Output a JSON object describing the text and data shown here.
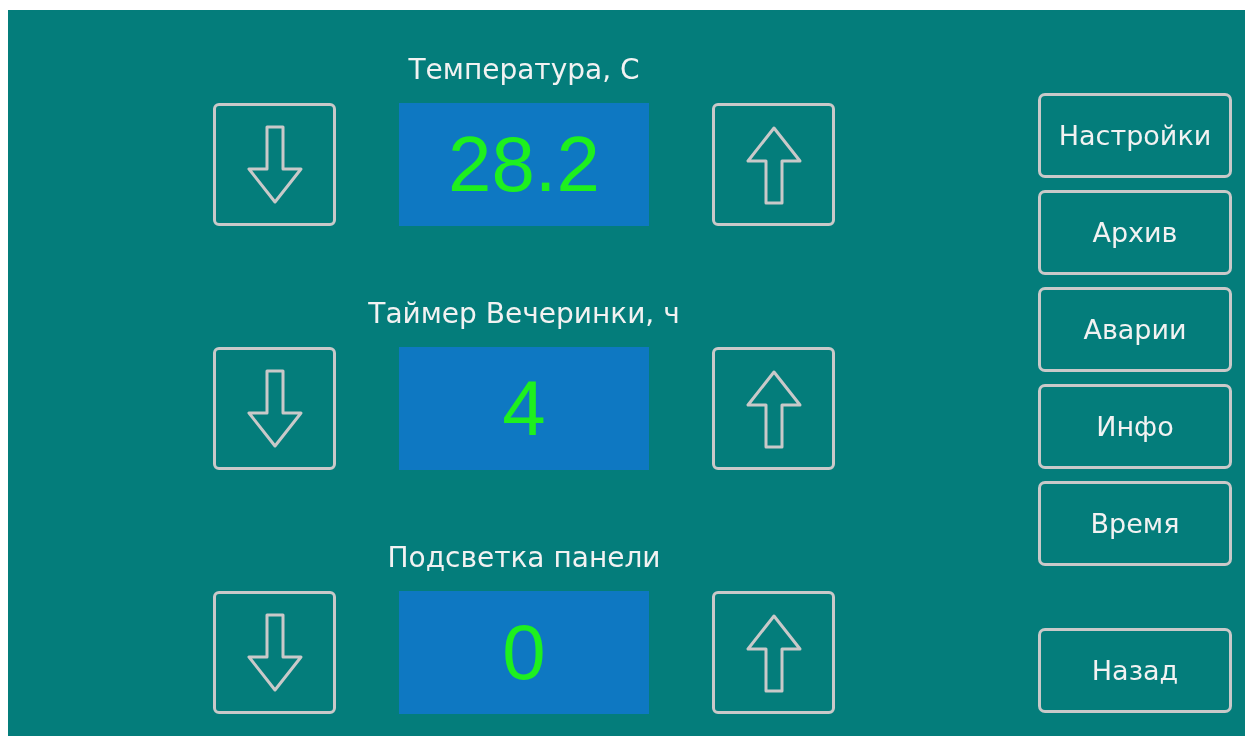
{
  "parameters": [
    {
      "label": "Температура, С",
      "value": "28.2"
    },
    {
      "label": "Таймер Вечеринки, ч",
      "value": "4"
    },
    {
      "label": "Подсветка панели",
      "value": "0"
    }
  ],
  "menu": [
    {
      "label": "Настройки"
    },
    {
      "label": "Архив"
    },
    {
      "label": "Аварии"
    },
    {
      "label": "Инфо"
    },
    {
      "label": "Время"
    }
  ],
  "back_button": {
    "label": "Назад"
  }
}
